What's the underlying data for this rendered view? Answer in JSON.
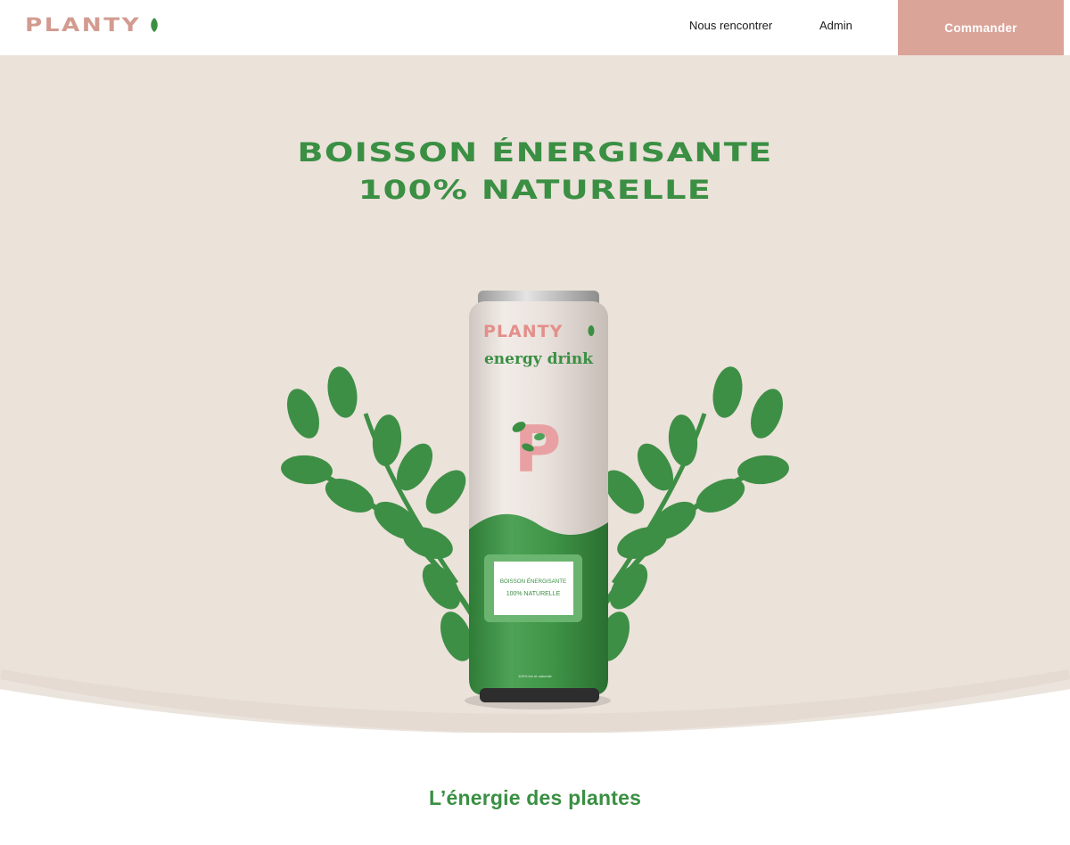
{
  "header": {
    "logo_text": "PLANTY",
    "nav": {
      "meet_label": "Nous rencontrer",
      "admin_label": "Admin"
    },
    "order_label": "Commander"
  },
  "hero": {
    "title_line1": "BOISSON ÉNERGISANTE",
    "title_line2": "100% NATURELLE"
  },
  "product": {
    "can_brand": "PLANTY",
    "can_subtitle": "energy drink",
    "can_letter": "P",
    "label_line1": "BOISSON ÉNERGISANTE",
    "label_line2": "100% NATURELLE",
    "fine_print": "100% bio et naturelle"
  },
  "section": {
    "title": "L’énergie des plantes"
  },
  "colors": {
    "brand_pink": "#dba499",
    "brand_green": "#3a8f43",
    "hero_bg": "#ebe2da"
  }
}
